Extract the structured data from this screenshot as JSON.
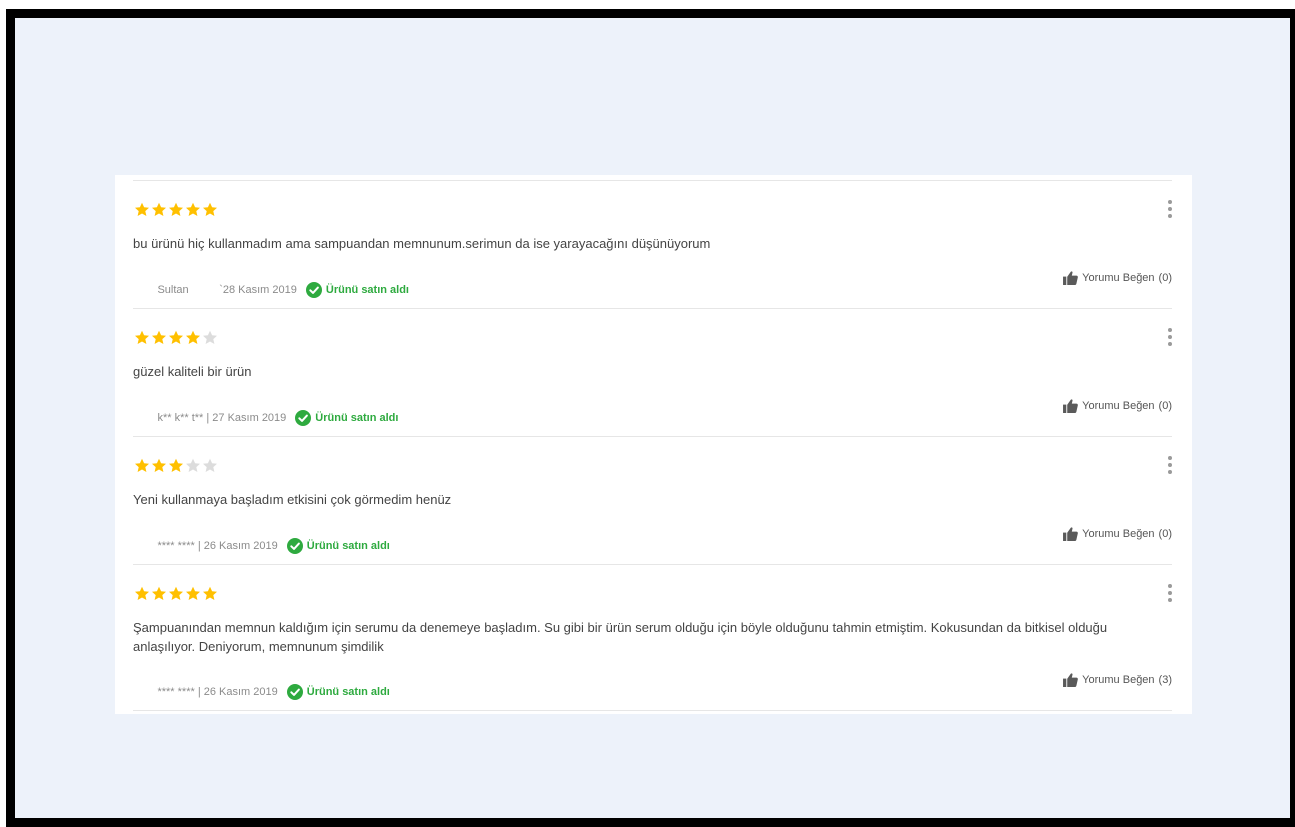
{
  "colors": {
    "star_filled": "#ffc000",
    "star_empty": "#dcdcdc",
    "verified": "#2eaa3f",
    "background": "#edf2fa"
  },
  "icons": {
    "star": "star-icon",
    "menu": "more-vertical-icon",
    "verified": "check-circle-icon",
    "like": "thumbs-up-icon"
  },
  "reviews": [
    {
      "rating": 5,
      "text": "bu ürünü hiç kullanmadım ama sampuandan memnunum.serimun da ise yarayacağını düşünüyorum",
      "author": "Sultan",
      "date": "`28 Kasım 2019",
      "verified_label": "Ürünü satın aldı",
      "like_label": "Yorumu Beğen",
      "like_count": "(0)"
    },
    {
      "rating": 4,
      "text": "güzel kaliteli bir ürün",
      "author": "k** k** t**",
      "date": "27 Kasım 2019",
      "verified_label": "Ürünü satın aldı",
      "like_label": "Yorumu Beğen",
      "like_count": "(0)"
    },
    {
      "rating": 3,
      "text": "Yeni kullanmaya başladım etkisini çok görmedim henüz",
      "author": "**** ****",
      "date": "26 Kasım 2019",
      "verified_label": "Ürünü satın aldı",
      "like_label": "Yorumu Beğen",
      "like_count": "(0)"
    },
    {
      "rating": 5,
      "text": "Şampuanından memnun kaldığım için serumu da denemeye başladım. Su gibi bir ürün serum olduğu için böyle olduğunu tahmin etmiştim. Kokusundan da bitkisel olduğu anlaşılıyor. Deniyorum, memnunum şimdilik",
      "author": "**** ****",
      "date": "26 Kasım 2019",
      "verified_label": "Ürünü satın aldı",
      "like_label": "Yorumu Beğen",
      "like_count": "(3)"
    }
  ]
}
